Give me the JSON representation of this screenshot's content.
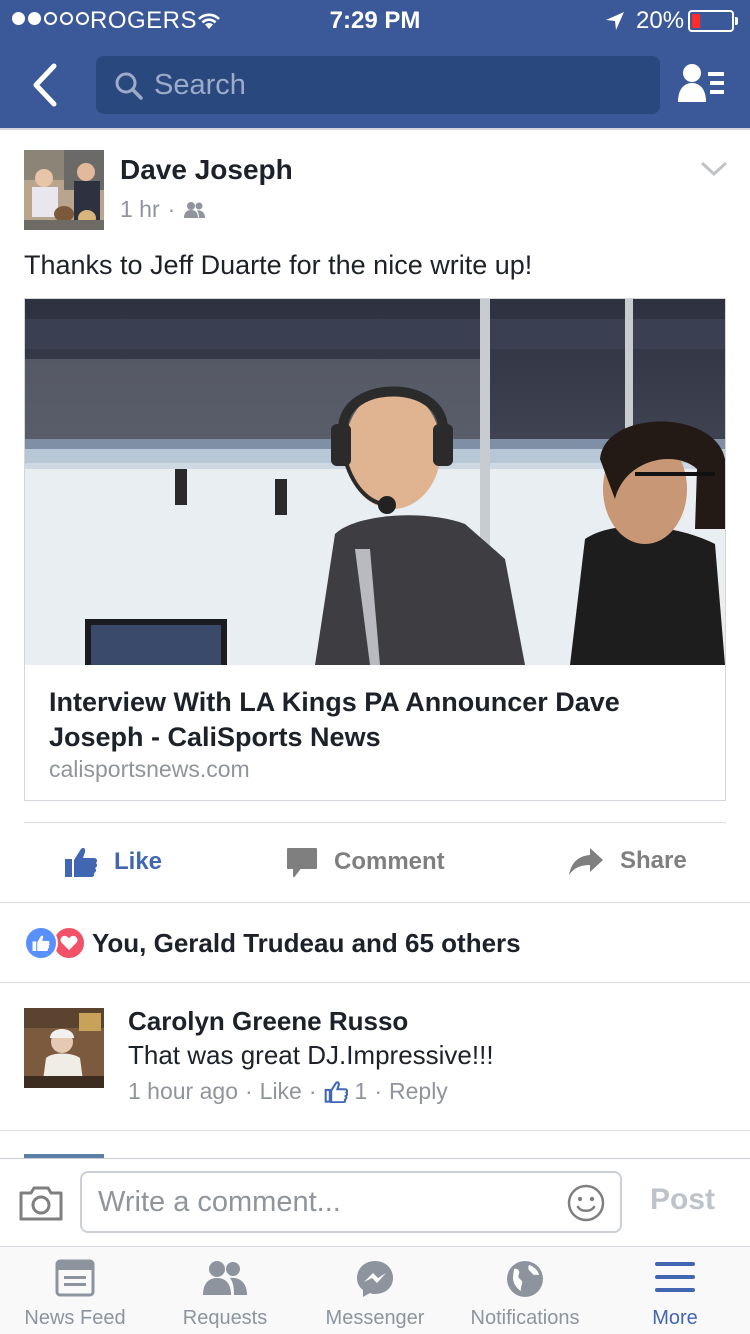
{
  "status_bar": {
    "signal_bars_on": 2,
    "signal_bars_total": 5,
    "carrier": "ROGERS",
    "time": "7:29 PM",
    "battery": "20%",
    "battery_level": 0.2
  },
  "nav": {
    "search_placeholder": "Search",
    "icons": [
      "back-arrow-icon",
      "search-icon",
      "friends-list-icon"
    ]
  },
  "post": {
    "author": "Dave Joseph",
    "time": "1 hr",
    "separator": "·",
    "audience_icon": "friends-icon",
    "text": "Thanks to Jeff Duarte for the nice write up!",
    "link": {
      "title": "Interview With LA Kings PA Announcer Dave Joseph - CaliSports News",
      "domain": "calisportsnews.com"
    }
  },
  "actions": {
    "like": "Like",
    "comment": "Comment",
    "share": "Share"
  },
  "reactions": {
    "summary": "You, Gerald Trudeau and 65 others",
    "types": [
      "like",
      "love"
    ]
  },
  "comments": [
    {
      "author": "Carolyn Greene Russo",
      "text": "That was great DJ.Impressive!!!",
      "time": "1 hour ago",
      "like": "Like",
      "like_count": "1",
      "reply": "Reply",
      "dot": "·"
    }
  ],
  "composer": {
    "placeholder": "Write a comment...",
    "post": "Post"
  },
  "tabs": [
    {
      "label": "News Feed",
      "icon": "news-feed-icon",
      "active": false
    },
    {
      "label": "Requests",
      "icon": "requests-icon",
      "active": false
    },
    {
      "label": "Messenger",
      "icon": "messenger-icon",
      "active": false
    },
    {
      "label": "Notifications",
      "icon": "globe-icon",
      "active": false
    },
    {
      "label": "More",
      "icon": "menu-icon",
      "active": true
    }
  ],
  "colors": {
    "brand_blue": "#3b5998",
    "search_bg": "#29487d",
    "link_blue": "#4267b2",
    "love_red": "#f25268",
    "battery_low": "#ff2a2a"
  }
}
